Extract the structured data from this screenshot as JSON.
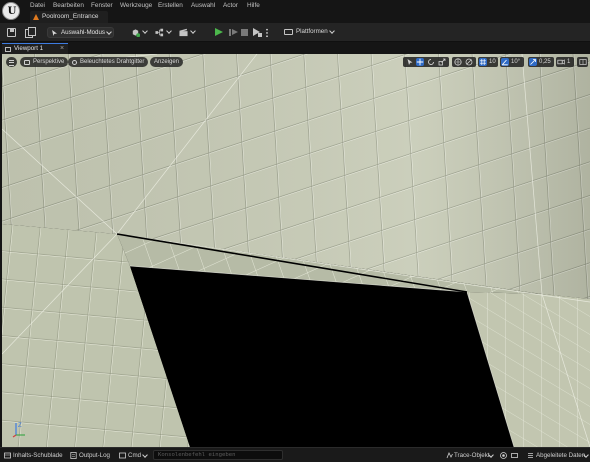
{
  "app": {
    "logo": "unreal-engine-logo",
    "level_name": "Poolroom_Entrance"
  },
  "menu": [
    "Datei",
    "Bearbeiten",
    "Fenster",
    "Werkzeuge",
    "Erstellen",
    "Auswahl",
    "Actor",
    "Hilfe"
  ],
  "toolbar": {
    "mode_label": "Auswahl-Modus",
    "platforms_label": "Plattformen",
    "play_color": "#4cb84c"
  },
  "viewport": {
    "tab_label": "Viewport 1",
    "close_glyph": "×",
    "perspective_label": "Perspektive",
    "view_mode_label": "Beleuchtetes Drahtgitter",
    "show_label": "Anzeigen",
    "grid_snap_value": "10",
    "rotation_snap_value": "10°",
    "scale_snap_value": "0,25",
    "camera_speed_value": "1",
    "accent_color": "#2f6bc6",
    "tile_color": "#c5c9b4",
    "axis_z_label": "Z"
  },
  "statusbar": {
    "content_drawer_label": "Inhalts-Schublade",
    "output_log_label": "Output-Log",
    "cmd_label": "Cmd",
    "console_placeholder": "Konsolenbefehl eingeben",
    "trace_label": "Trace-Objekt",
    "derived_data_label": "Abgeleitete Daten"
  }
}
